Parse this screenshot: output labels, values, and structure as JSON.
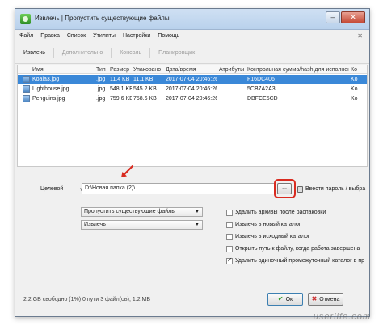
{
  "window": {
    "title": "Извлечь | Пропустить существующие файлы",
    "minimize_glyph": "–",
    "close_glyph": "✕"
  },
  "menu": [
    "Файл",
    "Правка",
    "Список",
    "Утилиты",
    "Настройки",
    "Помощь"
  ],
  "menu_close_glyph": "✕",
  "toolbar": [
    "Извлечь",
    "Дополнительно",
    "Консоль",
    "Планировщик"
  ],
  "columns": [
    "Имя",
    "Тип",
    "Размер",
    "Упаковано",
    "Дата/время",
    "Атрибуты",
    "Контрольная сумма/hash для исполнения",
    "Ко"
  ],
  "files": [
    {
      "name": "Koala3.jpg",
      "type": ".jpg",
      "size": "11.4 KB",
      "packed": "11.1 KB",
      "date": "2017-07-04 20:46:26",
      "attr": "",
      "crc": "F16DC406",
      "comment": "Ko",
      "selected": true
    },
    {
      "name": "Lighthouse.jpg",
      "type": ".jpg",
      "size": "548.1 KB",
      "packed": "545.2 KB",
      "date": "2017-07-04 20:46:26",
      "attr": "",
      "crc": "5CB7A2A3",
      "comment": "Ko",
      "selected": false
    },
    {
      "name": "Penguins.jpg",
      "type": ".jpg",
      "size": "759.6 KB",
      "packed": "758.6 KB",
      "date": "2017-07-04 20:46:26",
      "attr": "",
      "crc": "DBFCE5CD",
      "comment": "Ko",
      "selected": false
    }
  ],
  "target": {
    "label": "Целевой",
    "combo_glyph": "∨",
    "path": "D:\\Новая папка (2)\\",
    "browse_label": "...",
    "password_label": "Ввести пароль / выбра"
  },
  "dropdowns": {
    "overwrite": "Пропустить существующие файлы",
    "mode": "Извлечь",
    "arrow_glyph": "▼"
  },
  "options": [
    {
      "label": "Удалить архивы после распаковки",
      "checked": false
    },
    {
      "label": "Извлечь в новый каталог",
      "checked": false
    },
    {
      "label": "Извлечь в исходный каталог",
      "checked": false
    },
    {
      "label": "Открыть путь к файлу, когда работа завершена",
      "checked": false
    },
    {
      "label": "Удалить одиночный промежуточный каталог в пр",
      "checked": true
    }
  ],
  "status": "2.2 GB свободно (1%)   0 пути 3 файл(ов), 1.2 MB",
  "buttons": {
    "ok": "Ок",
    "ok_glyph": "✔",
    "cancel": "Отмена",
    "cancel_glyph": "✖"
  },
  "watermark": "userlife.com"
}
